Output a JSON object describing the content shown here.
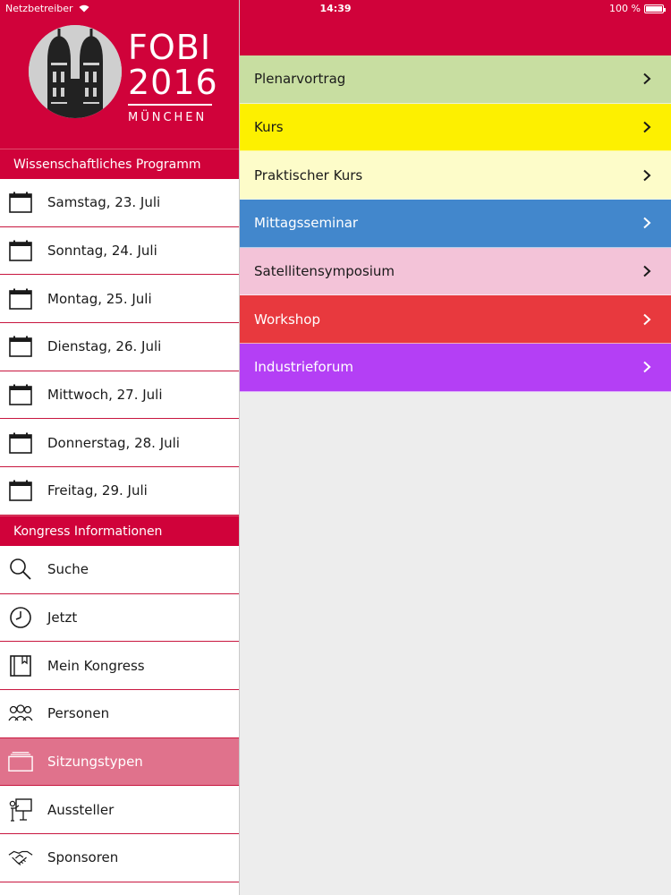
{
  "statusbar": {
    "carrier": "Netzbetreiber",
    "time": "14:39",
    "battery": "100 %"
  },
  "logo": {
    "line1": "FOBI",
    "line2": "2016",
    "city": "MÜNCHEN"
  },
  "sections": {
    "programm": "Wissenschaftliches Programm",
    "info": "Kongress Informationen"
  },
  "days": [
    {
      "label": "Samstag, 23. Juli"
    },
    {
      "label": "Sonntag, 24. Juli"
    },
    {
      "label": "Montag, 25. Juli"
    },
    {
      "label": "Dienstag, 26. Juli"
    },
    {
      "label": "Mittwoch, 27. Juli"
    },
    {
      "label": "Donnerstag, 28. Juli"
    },
    {
      "label": "Freitag, 29. Juli"
    }
  ],
  "info_items": [
    {
      "label": "Suche",
      "icon": "search-icon"
    },
    {
      "label": "Jetzt",
      "icon": "clock-icon"
    },
    {
      "label": "Mein Kongress",
      "icon": "bookmark-book-icon"
    },
    {
      "label": "Personen",
      "icon": "people-icon"
    },
    {
      "label": "Sitzungstypen",
      "icon": "folders-icon",
      "active": true
    },
    {
      "label": "Aussteller",
      "icon": "presenter-icon"
    },
    {
      "label": "Sponsoren",
      "icon": "handshake-icon"
    }
  ],
  "session_types": [
    {
      "label": "Plenarvortrag",
      "bg": "#c8dea1",
      "fg": "#1a1a1a"
    },
    {
      "label": "Kurs",
      "bg": "#fdf000",
      "fg": "#1a1a1a"
    },
    {
      "label": "Praktischer Kurs",
      "bg": "#fdfcc9",
      "fg": "#1a1a1a"
    },
    {
      "label": "Mittagsseminar",
      "bg": "#4287cc",
      "fg": "#ffffff"
    },
    {
      "label": "Satellitensymposium",
      "bg": "#f3c3d8",
      "fg": "#1a1a1a"
    },
    {
      "label": "Workshop",
      "bg": "#e8393e",
      "fg": "#ffffff"
    },
    {
      "label": "Industrieforum",
      "bg": "#b43ff5",
      "fg": "#ffffff"
    }
  ],
  "colors": {
    "brand": "#d0023a",
    "active": "#e0728c"
  }
}
